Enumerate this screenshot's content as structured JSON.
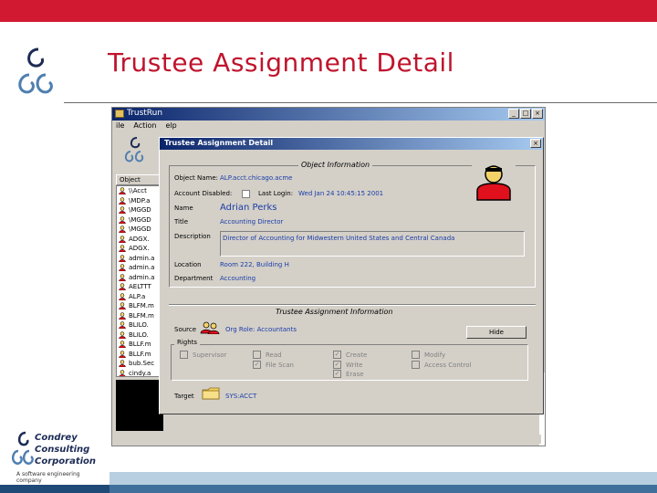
{
  "slide": {
    "title": "Trustee Assignment Detail",
    "brand_color": "#c0142d",
    "logo_lines": [
      "Condrey",
      "Consulting",
      "Corporation"
    ],
    "logo_tagline": "A software engineering company"
  },
  "app": {
    "title": "TrustRun",
    "menu": [
      "ile",
      "Action",
      "elp"
    ],
    "list_header": "Object",
    "list_items": [
      "\\\\Acct",
      "\\MDP.a",
      "\\MGGD",
      "\\MGGD",
      "\\MGGD",
      "ADGX.",
      "ADGX.",
      "admin.a",
      "admin.a",
      "admin.a",
      "AELTTT",
      "ALP.a",
      "BLFM.m",
      "BLFM.m",
      "BLILO.",
      "BLILO.",
      "BLLF.m",
      "BLLF.m",
      "bub.Sec",
      "cindy.a"
    ]
  },
  "dialog": {
    "title": "Trustee Assignment Detail",
    "object_section": "Object Information",
    "object_name_label": "Object Name:",
    "object_name_value": "ALP.acct.chicago.acme",
    "account_disabled_label": "Account Disabled:",
    "last_login_label": "Last Login:",
    "last_login_value": "Wed Jan 24 10:45:15 2001",
    "name_label": "Name",
    "name_value": "Adrian Perks",
    "title_label": "Title",
    "title_value": "Accounting Director",
    "description_label": "Description",
    "description_value": "Director of Accounting for Midwestern United States and Central Canada",
    "location_label": "Location",
    "location_value": "Room 222, Building H",
    "department_label": "Department",
    "department_value": "Accounting",
    "trustee_section": "Trustee Assignment Information",
    "source_label": "Source",
    "source_value": "Org Role: Accountants",
    "hide_button": "Hide",
    "rights_label": "Rights",
    "rights": [
      {
        "label": "Supervisor",
        "checked": false
      },
      {
        "label": "Read",
        "checked": false
      },
      {
        "label": "Create",
        "checked": true
      },
      {
        "label": "Modify",
        "checked": false
      },
      {
        "label": "File Scan",
        "checked": true
      },
      {
        "label": "Write",
        "checked": true
      },
      {
        "label": "Access Control",
        "checked": false
      },
      {
        "label": "Erase",
        "checked": true
      }
    ],
    "target_label": "Target",
    "target_value": "SYS:ACCT"
  }
}
